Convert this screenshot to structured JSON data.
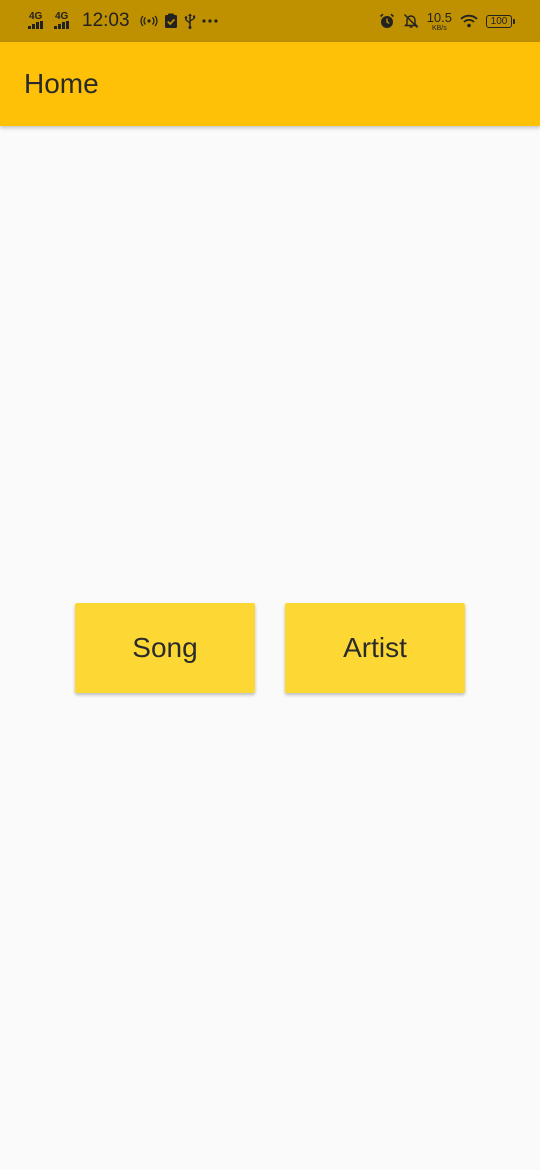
{
  "status_bar": {
    "network_1": "4G",
    "network_2": "4G",
    "time": "12:03",
    "speed_value": "10.5",
    "speed_unit": "KB/s",
    "battery": "100",
    "icons": [
      "hotspot-icon",
      "clipboard-check-icon",
      "usb-icon",
      "more-dots-icon",
      "alarm-icon",
      "notifications-off-icon",
      "wifi-icon",
      "battery-icon"
    ]
  },
  "app_bar": {
    "title": "Home"
  },
  "main": {
    "song_label": "Song",
    "artist_label": "Artist"
  },
  "colors": {
    "status_bar": "#bf9000",
    "app_bar": "#ffc107",
    "button": "#fdd835",
    "background": "#fafafa"
  }
}
